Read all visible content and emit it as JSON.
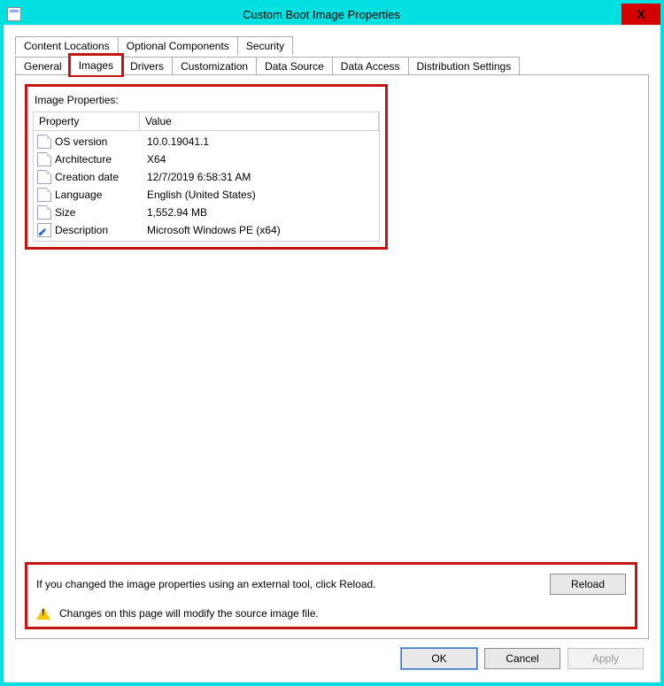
{
  "window": {
    "title": "Custom Boot Image Properties",
    "close_glyph": "X"
  },
  "tabs_row1": {
    "content_locations": "Content Locations",
    "optional_components": "Optional Components",
    "security": "Security"
  },
  "tabs_row2": {
    "general": "General",
    "images": "Images",
    "drivers": "Drivers",
    "customization": "Customization",
    "data_source": "Data Source",
    "data_access": "Data Access",
    "distribution_settings": "Distribution Settings"
  },
  "section": {
    "title": "Image Properties:",
    "col_property": "Property",
    "col_value": "Value",
    "rows": [
      {
        "prop": "OS version",
        "val": "10.0.19041.1"
      },
      {
        "prop": "Architecture",
        "val": "X64"
      },
      {
        "prop": "Creation date",
        "val": "12/7/2019 6:58:31 AM"
      },
      {
        "prop": "Language",
        "val": "English (United States)"
      },
      {
        "prop": "Size",
        "val": "1,552.94 MB"
      },
      {
        "prop": "Description",
        "val": "Microsoft Windows PE (x64)"
      }
    ]
  },
  "bottom": {
    "reload_msg": "If you changed the image properties using an external tool, click Reload.",
    "reload_label": "Reload",
    "warn_msg": "Changes on this page will modify the source image file."
  },
  "buttons": {
    "ok": "OK",
    "cancel": "Cancel",
    "apply": "Apply"
  }
}
